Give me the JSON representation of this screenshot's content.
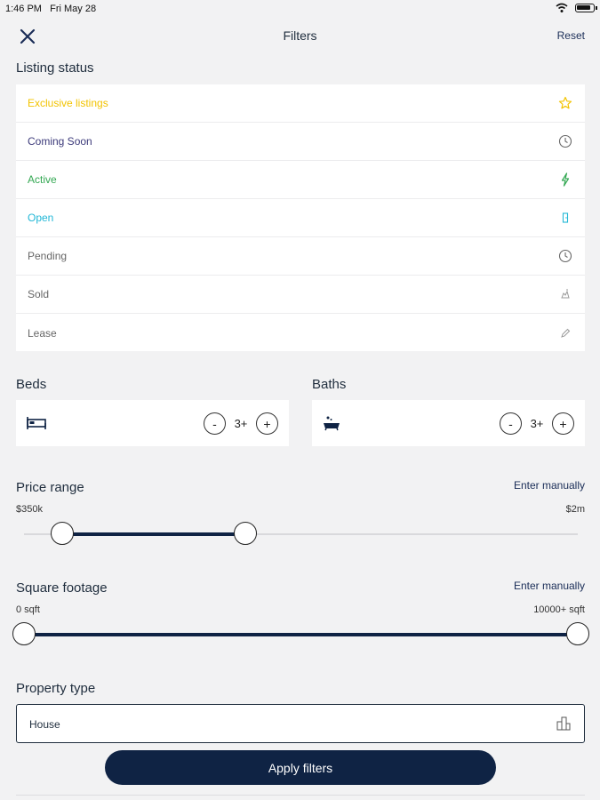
{
  "status_bar": {
    "time": "1:46 PM",
    "date": "Fri May 28"
  },
  "header": {
    "title": "Filters",
    "reset_label": "Reset"
  },
  "listing_status": {
    "title": "Listing status",
    "items": [
      {
        "label": "Exclusive listings",
        "color": "#f2c300",
        "icon": "star-icon"
      },
      {
        "label": "Coming Soon",
        "color": "#3c3a7a",
        "icon": "clock-icon"
      },
      {
        "label": "Active",
        "color": "#34a853",
        "icon": "lightning-icon"
      },
      {
        "label": "Open",
        "color": "#22b7d6",
        "icon": "door-icon"
      },
      {
        "label": "Pending",
        "color": "#666666",
        "icon": "clock-icon"
      },
      {
        "label": "Sold",
        "color": "#666666",
        "icon": "sold-icon"
      },
      {
        "label": "Lease",
        "color": "#666666",
        "icon": "pen-icon"
      }
    ]
  },
  "beds": {
    "title": "Beds",
    "value": "3+",
    "minus": "-",
    "plus": "+"
  },
  "baths": {
    "title": "Baths",
    "value": "3+",
    "minus": "-",
    "plus": "+"
  },
  "price_range": {
    "title": "Price range",
    "enter_manually": "Enter manually",
    "min_label": "$350k",
    "max_label": "$2m"
  },
  "square_footage": {
    "title": "Square footage",
    "enter_manually": "Enter manually",
    "min_label": "0 sqft",
    "max_label": "10000+ sqft"
  },
  "property_type": {
    "title": "Property type",
    "selected": "House"
  },
  "apply_label": "Apply filters",
  "colors": {
    "accent": "#0f2344",
    "background": "#f2f2f3"
  }
}
